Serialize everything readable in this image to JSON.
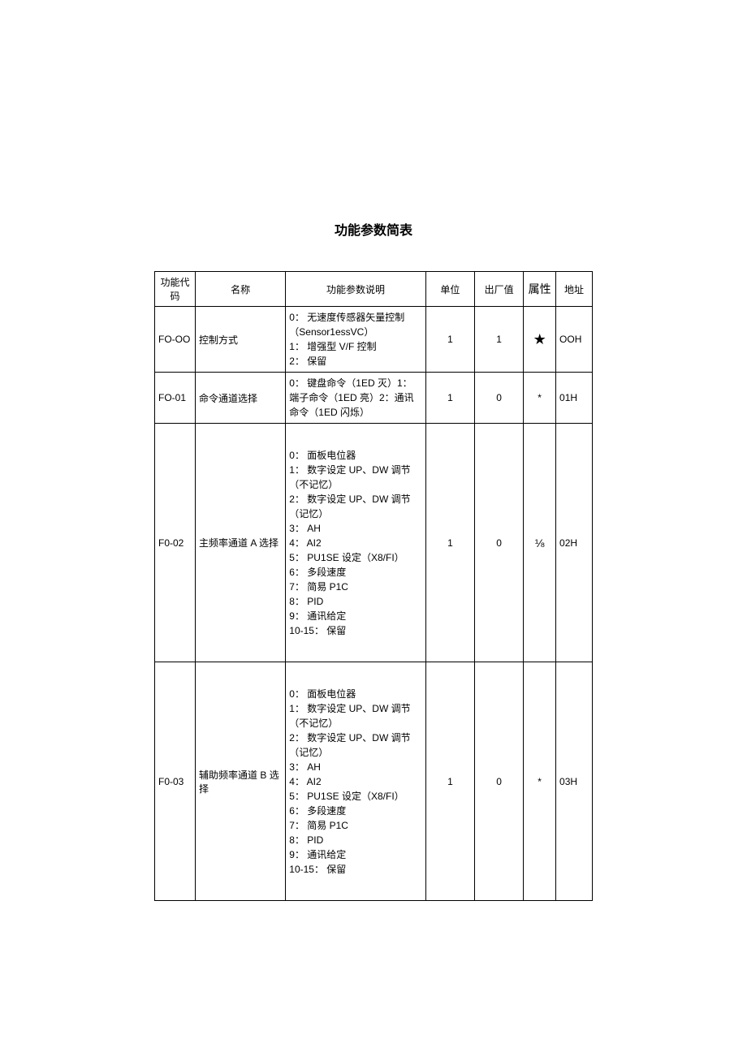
{
  "title": "功能参数简表",
  "headers": {
    "code": "功能代码",
    "name": "名称",
    "desc": "功能参数说明",
    "unit": "单位",
    "default": "出厂值",
    "attr": "属性",
    "addr": "地址"
  },
  "rows": [
    {
      "code": "FO-OO",
      "name": "控制方式",
      "desc": "0： 无速度传感器矢量控制（Sensor1essVC）\n1： 增强型 V/F 控制\n2： 保留",
      "unit": "1",
      "default": "1",
      "attr": "★",
      "addr": "OOH"
    },
    {
      "code": "FO-01",
      "name": "命令通道选择",
      "desc": "0： 键盘命令（1ED 灭）1： 端子命令（1ED 亮）2：通讯命令（1ED 闪烁）",
      "unit": "1",
      "default": "0",
      "attr": "*",
      "addr": "01H"
    },
    {
      "code": "F0-02",
      "name": "主频率通道 A 选择",
      "desc": "0： 面板电位器\n1： 数字设定 UP、DW 调节（不记忆）\n2： 数字设定 UP、DW 调节（记忆）\n3： AH\n4： AI2\n5： PU1SE 设定（X8/FI）\n6： 多段速度\n7： 简易 P1C\n8： PID\n9： 通讯给定\n10-15： 保留",
      "unit": "1",
      "default": "0",
      "attr": "⅛",
      "addr": "02H"
    },
    {
      "code": "F0-03",
      "name": "辅助频率通道 B 选择",
      "desc": "0： 面板电位器\n1： 数字设定 UP、DW 调节（不记忆）\n2： 数字设定 UP、DW 调节（记忆）\n3： AH\n4： AI2\n5： PU1SE 设定（X8/FI）\n6： 多段速度\n7： 简易 P1C\n8： PID\n9： 通讯给定\n10-15： 保留",
      "unit": "1",
      "default": "0",
      "attr": "*",
      "addr": "03H"
    }
  ]
}
